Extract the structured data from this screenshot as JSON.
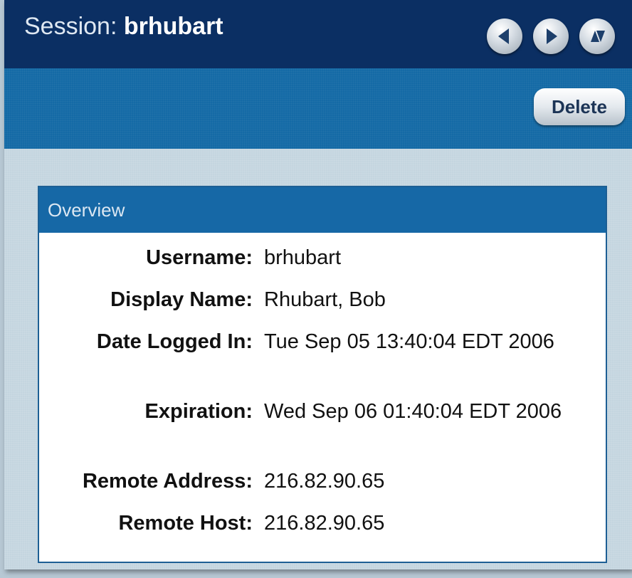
{
  "header": {
    "title_prefix": "Session: ",
    "title_user": "brhubart",
    "nav_icons": [
      "back-arrow-icon",
      "forward-arrow-icon",
      "expand-collapse-icon"
    ]
  },
  "toolbar": {
    "delete_label": "Delete"
  },
  "overview": {
    "title": "Overview",
    "fields": [
      {
        "label": "Username:",
        "value": "brhubart"
      },
      {
        "label": "Display Name:",
        "value": "Rhubart, Bob"
      },
      {
        "label": "Date Logged In:",
        "value": "Tue Sep 05 13:40:04 EDT 2006"
      },
      {
        "label": "Expiration:",
        "value": "Wed Sep 06 01:40:04 EDT 2006"
      },
      {
        "label": "Remote Address:",
        "value": "216.82.90.65"
      },
      {
        "label": "Remote Host:",
        "value": "216.82.90.65"
      }
    ]
  },
  "colors": {
    "title_bar": "#0b2f63",
    "toolbar": "#146aa6",
    "body": "#c4d5df",
    "overview_header": "#1668a6"
  }
}
